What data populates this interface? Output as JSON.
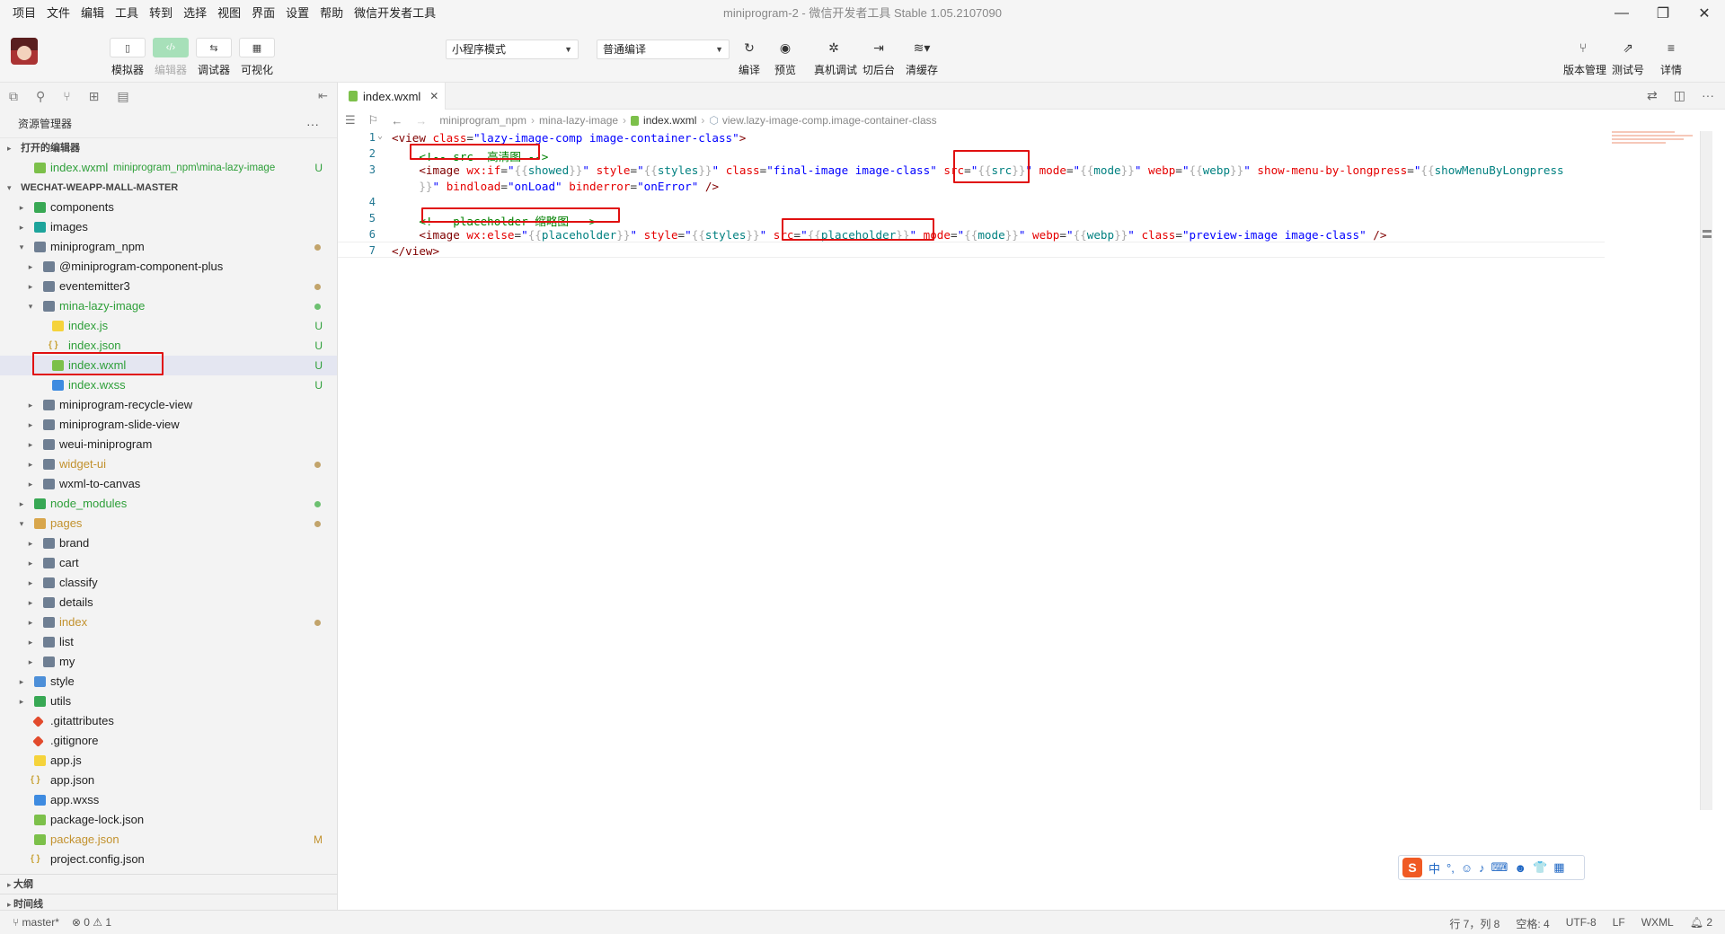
{
  "menubar": {
    "items": [
      "项目",
      "文件",
      "编辑",
      "工具",
      "转到",
      "选择",
      "视图",
      "界面",
      "设置",
      "帮助",
      "微信开发者工具"
    ],
    "window_title": "miniprogram-2 - 微信开发者工具 Stable 1.05.2107090"
  },
  "toolbar": {
    "left_buttons": [
      {
        "label": "模拟器",
        "icon": "phone-icon"
      },
      {
        "label": "编辑器",
        "icon": "code-icon"
      },
      {
        "label": "调试器",
        "icon": "debug-icon"
      },
      {
        "label": "可视化",
        "icon": "layout-icon"
      }
    ],
    "mode_select": "小程序模式",
    "compile_select": "普通编译",
    "center_buttons": [
      {
        "label": "编译",
        "icon": "refresh-icon"
      },
      {
        "label": "预览",
        "icon": "eye-icon"
      },
      {
        "label": "真机调试",
        "icon": "bug-icon"
      },
      {
        "label": "切后台",
        "icon": "background-icon"
      },
      {
        "label": "清缓存",
        "icon": "layers-icon"
      }
    ],
    "right_buttons": [
      {
        "label": "版本管理",
        "icon": "branch-icon"
      },
      {
        "label": "测试号",
        "icon": "external-icon"
      },
      {
        "label": "详情",
        "icon": "menu-icon"
      }
    ]
  },
  "sidebar": {
    "title": "资源管理器",
    "open_editors_label": "打开的编辑器",
    "open_editor": {
      "name": "index.wxml",
      "path": "miniprogram_npm\\mina-lazy-image",
      "badge": "U"
    },
    "project_label": "WECHAT-WEAPP-MALL-MASTER",
    "tree": [
      {
        "name": "components",
        "depth": 0,
        "type": "folder-green",
        "twisty": "▸"
      },
      {
        "name": "images",
        "depth": 0,
        "type": "folder-teal",
        "twisty": "▸"
      },
      {
        "name": "miniprogram_npm",
        "depth": 0,
        "type": "folder",
        "twisty": "▾",
        "dot": "#c2a46b"
      },
      {
        "name": "@miniprogram-component-plus",
        "depth": 1,
        "type": "folder",
        "twisty": "▸"
      },
      {
        "name": "eventemitter3",
        "depth": 1,
        "type": "folder",
        "twisty": "▸",
        "dot": "#c2a46b"
      },
      {
        "name": "mina-lazy-image",
        "depth": 1,
        "type": "folder",
        "twisty": "▾",
        "color": "green",
        "dot": "#6cc070"
      },
      {
        "name": "index.js",
        "depth": 2,
        "type": "file-js",
        "color": "green",
        "badge": "U"
      },
      {
        "name": "index.json",
        "depth": 2,
        "type": "file-json",
        "color": "green",
        "badge": "U"
      },
      {
        "name": "index.wxml",
        "depth": 2,
        "type": "file-wxml",
        "color": "green",
        "badge": "U",
        "selected": true
      },
      {
        "name": "index.wxss",
        "depth": 2,
        "type": "file-wxss",
        "color": "green",
        "badge": "U"
      },
      {
        "name": "miniprogram-recycle-view",
        "depth": 1,
        "type": "folder",
        "twisty": "▸"
      },
      {
        "name": "miniprogram-slide-view",
        "depth": 1,
        "type": "folder",
        "twisty": "▸"
      },
      {
        "name": "weui-miniprogram",
        "depth": 1,
        "type": "folder",
        "twisty": "▸"
      },
      {
        "name": "widget-ui",
        "depth": 1,
        "type": "folder",
        "twisty": "▸",
        "color": "orange",
        "dot": "#c2a46b"
      },
      {
        "name": "wxml-to-canvas",
        "depth": 1,
        "type": "folder",
        "twisty": "▸"
      },
      {
        "name": "node_modules",
        "depth": 0,
        "type": "folder-green",
        "twisty": "▸",
        "color": "green",
        "dot": "#6cc070"
      },
      {
        "name": "pages",
        "depth": 0,
        "type": "folder-orange",
        "twisty": "▾",
        "color": "orange",
        "dot": "#c2a46b"
      },
      {
        "name": "brand",
        "depth": 1,
        "type": "folder",
        "twisty": "▸"
      },
      {
        "name": "cart",
        "depth": 1,
        "type": "folder",
        "twisty": "▸"
      },
      {
        "name": "classify",
        "depth": 1,
        "type": "folder",
        "twisty": "▸"
      },
      {
        "name": "details",
        "depth": 1,
        "type": "folder",
        "twisty": "▸"
      },
      {
        "name": "index",
        "depth": 1,
        "type": "folder",
        "twisty": "▸",
        "color": "orange",
        "dot": "#c2a46b"
      },
      {
        "name": "list",
        "depth": 1,
        "type": "folder",
        "twisty": "▸"
      },
      {
        "name": "my",
        "depth": 1,
        "type": "folder",
        "twisty": "▸"
      },
      {
        "name": "style",
        "depth": 0,
        "type": "folder-blue",
        "twisty": "▸"
      },
      {
        "name": "utils",
        "depth": 0,
        "type": "folder-green",
        "twisty": "▸"
      },
      {
        "name": ".gitattributes",
        "depth": 0,
        "type": "file-git"
      },
      {
        "name": ".gitignore",
        "depth": 0,
        "type": "file-git"
      },
      {
        "name": "app.js",
        "depth": 0,
        "type": "file-js"
      },
      {
        "name": "app.json",
        "depth": 0,
        "type": "file-json"
      },
      {
        "name": "app.wxss",
        "depth": 0,
        "type": "file-wxss"
      },
      {
        "name": "package-lock.json",
        "depth": 0,
        "type": "file-wxml"
      },
      {
        "name": "package.json",
        "depth": 0,
        "type": "file-wxml",
        "color": "orange",
        "badge": "M"
      },
      {
        "name": "project.config.json",
        "depth": 0,
        "type": "file-json"
      }
    ],
    "outline_label": "大纲",
    "timeline_label": "时间线"
  },
  "editor": {
    "tab": {
      "name": "index.wxml"
    },
    "breadcrumb": [
      "miniprogram_npm",
      "mina-lazy-image",
      "index.wxml",
      "view.lazy-image-comp.image-container-class"
    ],
    "line_numbers": [
      "1",
      "2",
      "3",
      "",
      "4",
      "5",
      "6",
      "7"
    ],
    "lines": [
      [
        [
          "t-tag",
          "<view "
        ],
        [
          "t-attr",
          "class"
        ],
        [
          "t-eq",
          "="
        ],
        [
          "t-str",
          "\"lazy-image-comp image-container-class\""
        ],
        [
          "t-tag",
          ">"
        ]
      ],
      [
        [
          "t-eq",
          "    "
        ],
        [
          "t-cm",
          "<!-- src  高清图 -->"
        ]
      ],
      [
        [
          "t-eq",
          "    "
        ],
        [
          "t-tag",
          "<image "
        ],
        [
          "t-attr",
          "wx:if"
        ],
        [
          "t-eq",
          "="
        ],
        [
          "t-str",
          "\""
        ],
        [
          "t-mus",
          "{{"
        ],
        [
          "t-var",
          "showed"
        ],
        [
          "t-mus",
          "}}"
        ],
        [
          "t-str",
          "\""
        ],
        [
          "t-eq",
          " "
        ],
        [
          "t-attr",
          "style"
        ],
        [
          "t-eq",
          "="
        ],
        [
          "t-str",
          "\""
        ],
        [
          "t-mus",
          "{{"
        ],
        [
          "t-var",
          "styles"
        ],
        [
          "t-mus",
          "}}"
        ],
        [
          "t-str",
          "\""
        ],
        [
          "t-eq",
          " "
        ],
        [
          "t-attr",
          "class"
        ],
        [
          "t-eq",
          "="
        ],
        [
          "t-str",
          "\"final-image image-class\""
        ],
        [
          "t-eq",
          " "
        ],
        [
          "t-attr",
          "src"
        ],
        [
          "t-eq",
          "="
        ],
        [
          "t-str",
          "\""
        ],
        [
          "t-mus",
          "{{"
        ],
        [
          "t-var",
          "src"
        ],
        [
          "t-mus",
          "}}"
        ],
        [
          "t-str",
          "\""
        ],
        [
          "t-eq",
          " "
        ],
        [
          "t-attr",
          "mode"
        ],
        [
          "t-eq",
          "="
        ],
        [
          "t-str",
          "\""
        ],
        [
          "t-mus",
          "{{"
        ],
        [
          "t-var",
          "mode"
        ],
        [
          "t-mus",
          "}}"
        ],
        [
          "t-str",
          "\""
        ],
        [
          "t-eq",
          " "
        ],
        [
          "t-attr",
          "webp"
        ],
        [
          "t-eq",
          "="
        ],
        [
          "t-str",
          "\""
        ],
        [
          "t-mus",
          "{{"
        ],
        [
          "t-var",
          "webp"
        ],
        [
          "t-mus",
          "}}"
        ],
        [
          "t-str",
          "\""
        ],
        [
          "t-eq",
          " "
        ],
        [
          "t-attr",
          "show-menu-by-longpress"
        ],
        [
          "t-eq",
          "="
        ],
        [
          "t-str",
          "\""
        ],
        [
          "t-mus",
          "{{"
        ],
        [
          "t-var",
          "showMenuByLongpress"
        ]
      ],
      [
        [
          "t-eq",
          "    "
        ],
        [
          "t-mus",
          "}}"
        ],
        [
          "t-str",
          "\""
        ],
        [
          "t-eq",
          " "
        ],
        [
          "t-attr",
          "bindload"
        ],
        [
          "t-eq",
          "="
        ],
        [
          "t-str",
          "\"onLoad\""
        ],
        [
          "t-eq",
          " "
        ],
        [
          "t-attr",
          "binderror"
        ],
        [
          "t-eq",
          "="
        ],
        [
          "t-str",
          "\"onError\""
        ],
        [
          "t-eq",
          " "
        ],
        [
          "t-tag",
          "/>"
        ]
      ],
      [],
      [
        [
          "t-eq",
          "    "
        ],
        [
          "t-cm",
          "<!-- placeholder 缩略图 -->"
        ]
      ],
      [
        [
          "t-eq",
          "    "
        ],
        [
          "t-tag",
          "<image "
        ],
        [
          "t-attr",
          "wx:else"
        ],
        [
          "t-eq",
          "="
        ],
        [
          "t-str",
          "\""
        ],
        [
          "t-mus",
          "{{"
        ],
        [
          "t-var",
          "placeholder"
        ],
        [
          "t-mus",
          "}}"
        ],
        [
          "t-str",
          "\""
        ],
        [
          "t-eq",
          " "
        ],
        [
          "t-attr",
          "style"
        ],
        [
          "t-eq",
          "="
        ],
        [
          "t-str",
          "\""
        ],
        [
          "t-mus",
          "{{"
        ],
        [
          "t-var",
          "styles"
        ],
        [
          "t-mus",
          "}}"
        ],
        [
          "t-str",
          "\""
        ],
        [
          "t-eq",
          " "
        ],
        [
          "t-attr",
          "src"
        ],
        [
          "t-eq",
          "="
        ],
        [
          "t-str",
          "\""
        ],
        [
          "t-mus",
          "{{"
        ],
        [
          "t-var",
          "placeholder"
        ],
        [
          "t-mus",
          "}}"
        ],
        [
          "t-str",
          "\""
        ],
        [
          "t-eq",
          " "
        ],
        [
          "t-attr",
          "mode"
        ],
        [
          "t-eq",
          "="
        ],
        [
          "t-str",
          "\""
        ],
        [
          "t-mus",
          "{{"
        ],
        [
          "t-var",
          "mode"
        ],
        [
          "t-mus",
          "}}"
        ],
        [
          "t-str",
          "\""
        ],
        [
          "t-eq",
          " "
        ],
        [
          "t-attr",
          "webp"
        ],
        [
          "t-eq",
          "="
        ],
        [
          "t-str",
          "\""
        ],
        [
          "t-mus",
          "{{"
        ],
        [
          "t-var",
          "webp"
        ],
        [
          "t-mus",
          "}}"
        ],
        [
          "t-str",
          "\""
        ],
        [
          "t-eq",
          " "
        ],
        [
          "t-attr",
          "class"
        ],
        [
          "t-eq",
          "="
        ],
        [
          "t-str",
          "\"preview-image image-class\""
        ],
        [
          "t-eq",
          " "
        ],
        [
          "t-tag",
          "/>"
        ]
      ],
      [
        [
          "t-tag",
          "</view>"
        ]
      ]
    ]
  },
  "ime": {
    "lang": "中",
    "punct": "°,"
  },
  "statusbar": {
    "branch": "master*",
    "problems": "⊗ 0 ⚠ 1",
    "position": "行 7，列 8",
    "indent": "空格: 4",
    "encoding": "UTF-8",
    "eol": "LF",
    "language": "WXML",
    "notifications": "2"
  }
}
